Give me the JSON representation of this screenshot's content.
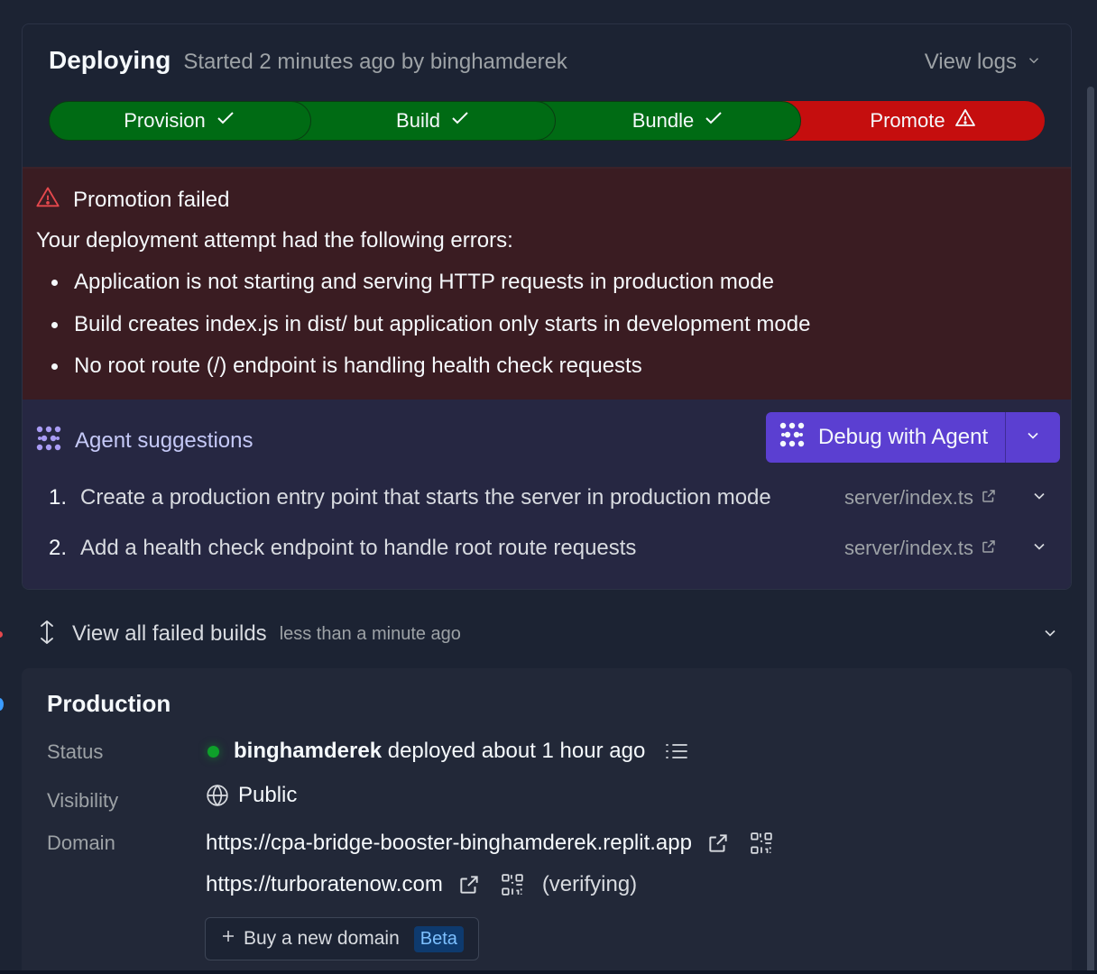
{
  "deploy": {
    "title": "Deploying",
    "started": "Started 2 minutes ago by binghamderek",
    "view_logs": "View logs",
    "steps": [
      {
        "label": "Provision",
        "status": "done"
      },
      {
        "label": "Build",
        "status": "done"
      },
      {
        "label": "Bundle",
        "status": "done"
      },
      {
        "label": "Promote",
        "status": "failed"
      }
    ]
  },
  "error": {
    "title": "Promotion failed",
    "intro": "Your deployment attempt had the following errors:",
    "items": [
      "Application is not starting and serving HTTP requests in production mode",
      "Build creates index.js in dist/ but application only starts in development mode",
      "No root route (/) endpoint is handling health check requests"
    ]
  },
  "agent": {
    "title": "Agent suggestions",
    "debug_label": "Debug with Agent",
    "suggestions": [
      {
        "num": "1.",
        "text": "Create a production entry point that starts the server in production mode",
        "file": "server/index.ts"
      },
      {
        "num": "2.",
        "text": "Add a health check endpoint to handle root route requests",
        "file": "server/index.ts"
      }
    ]
  },
  "failed_builds": {
    "label": "View all failed builds",
    "time": "less than a minute ago"
  },
  "production": {
    "title": "Production",
    "status_label": "Status",
    "status_user": "binghamderek",
    "status_text": " deployed about 1 hour ago",
    "visibility_label": "Visibility",
    "visibility_value": "Public",
    "domain_label": "Domain",
    "domain_primary": "https://cpa-bridge-booster-binghamderek.replit.app",
    "domain_secondary": "https://turboratenow.com",
    "domain_secondary_status": "(verifying)",
    "buy_domain_label": "Buy a new domain",
    "beta_badge": "Beta"
  },
  "colors": {
    "step_done": "#006b14",
    "step_failed": "#c50e0e",
    "error_bg": "#3a1c22",
    "agent_bg": "#262742",
    "debug_button": "#5b3fd1",
    "status_dot": "#0ea02a"
  },
  "icons": [
    "check-icon",
    "warning-icon",
    "chevron-down-icon",
    "agent-icon",
    "external-link-icon",
    "expand-vertical-icon",
    "list-icon",
    "globe-icon",
    "qr-code-icon",
    "plus-icon"
  ]
}
